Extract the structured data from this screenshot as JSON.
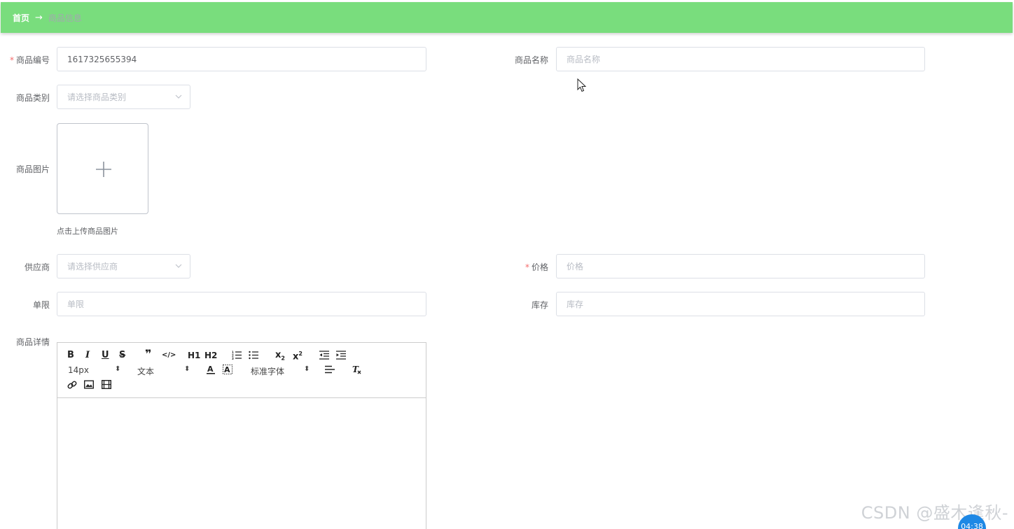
{
  "theme": {
    "accent": "#79dd7d"
  },
  "breadcrumb": {
    "home": "首页",
    "separator": "→",
    "current": "商品信息"
  },
  "form": {
    "code": {
      "label": "商品编号",
      "value": "1617325655394",
      "required": true
    },
    "name": {
      "label": "商品名称",
      "placeholder": "商品名称"
    },
    "category": {
      "label": "商品类别",
      "placeholder": "请选择商品类别"
    },
    "image": {
      "label": "商品图片",
      "tip": "点击上传商品图片"
    },
    "supplier": {
      "label": "供应商",
      "placeholder": "请选择供应商"
    },
    "price": {
      "label": "价格",
      "placeholder": "价格",
      "required": true
    },
    "limit": {
      "label": "单限",
      "placeholder": "单限"
    },
    "stock": {
      "label": "库存",
      "placeholder": "库存"
    },
    "detail": {
      "label": "商品详情"
    }
  },
  "editor": {
    "size": "14px",
    "header": "文本",
    "font": "标准字体",
    "h1": "H1",
    "h2": "H2"
  },
  "overlay": {
    "watermark": "CSDN @盛木逢秋-",
    "timer": "04:38"
  }
}
